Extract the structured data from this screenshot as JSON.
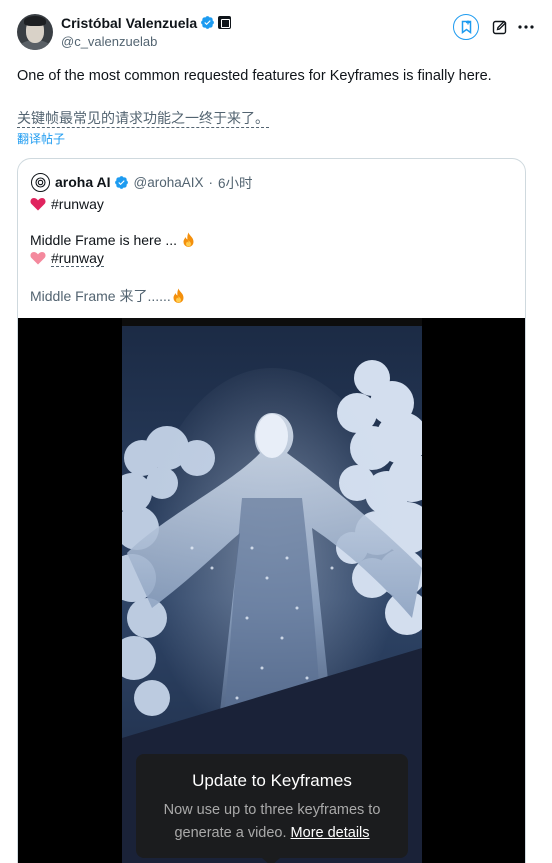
{
  "author": {
    "display_name": "Cristóbal Valenzuela",
    "handle": "@c_valenzuelab"
  },
  "top_actions": {
    "bookmark_icon": "bookmark-icon",
    "edit_icon": "edit-icon",
    "more_icon": "more-icon"
  },
  "tweet": {
    "text": "One of the most common requested features for Keyframes is finally here.",
    "translation": "关键帧最常见的请求功能之一终于来了。",
    "translate_link": "翻译帖子"
  },
  "quote": {
    "name": "aroha AI",
    "handle": "@arohaAIX",
    "separator": "·",
    "time": "6小时",
    "line1": "#runway",
    "line2": "Middle Frame is here ...",
    "line3": "#runway",
    "line4": "Middle Frame 来了......"
  },
  "media": {
    "tooltip_title": "Update to Keyframes",
    "tooltip_body_1": "Now use up to three keyframes to",
    "tooltip_body_2": "generate a video.",
    "tooltip_link": "More details"
  },
  "colors": {
    "verified": "#1d9bf0",
    "link": "#1d9bf0",
    "heart_red": "#e0245e",
    "heart_pink": "#f4899d"
  }
}
